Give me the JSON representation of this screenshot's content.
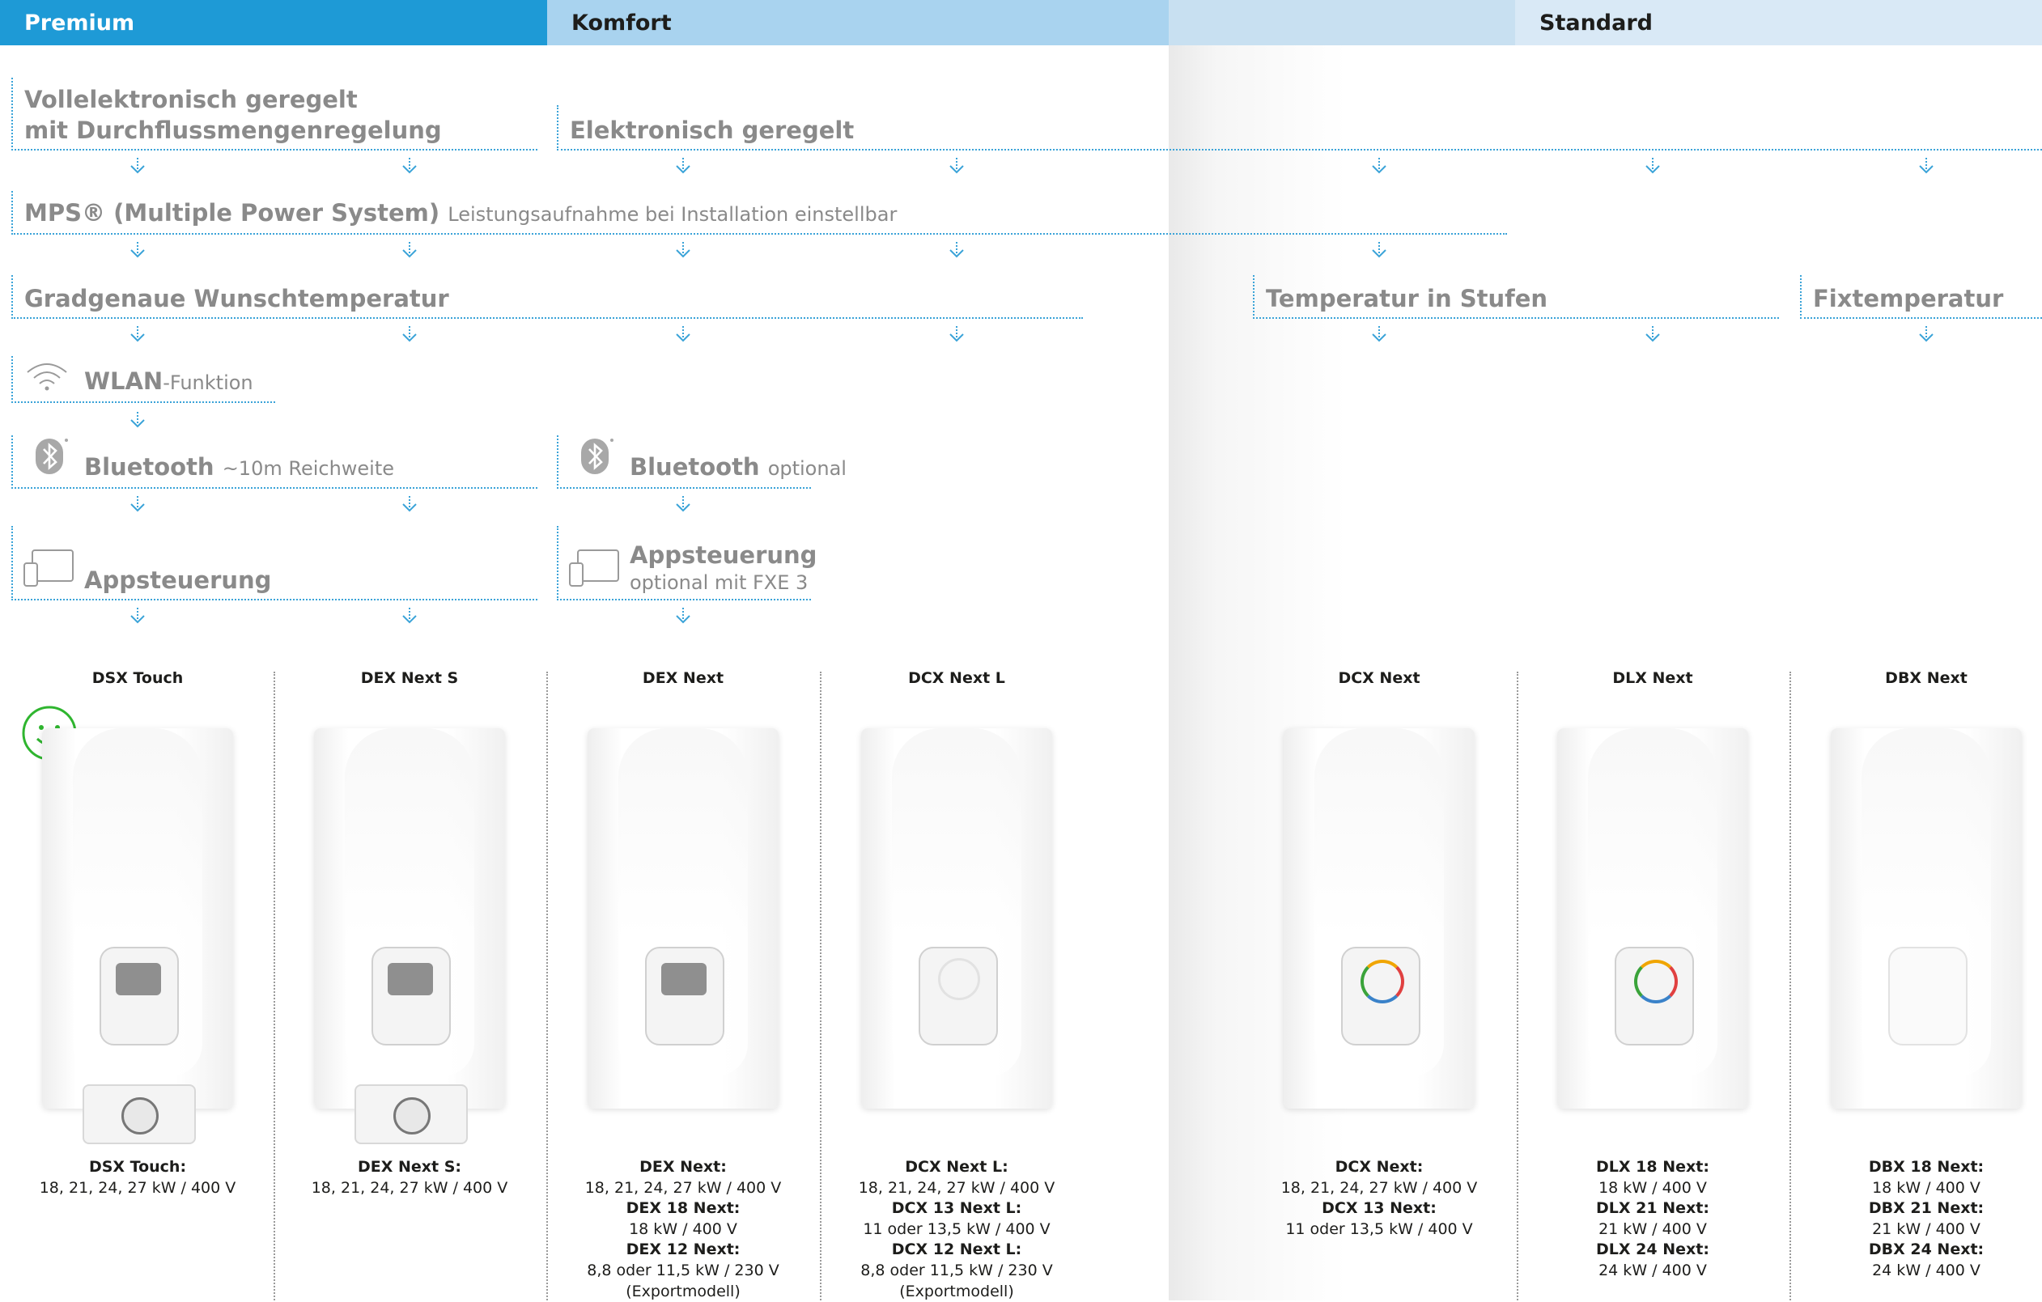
{
  "bands": {
    "premium": "Premium",
    "komfort": "Komfort",
    "standard": "Standard"
  },
  "features": {
    "vollelektronisch_line1": "Vollelektronisch geregelt",
    "vollelektronisch_line2": "mit Durchflussmengenregelung",
    "elektronisch": "Elektronisch geregelt",
    "mps_bold": "MPS® (Multiple Power System)",
    "mps_light": "Leistungsaufnahme bei Installation einstellbar",
    "gradgenau": "Gradgenaue Wunschtemperatur",
    "temperatur_stufen": "Temperatur in Stufen",
    "fixtemperatur": "Fixtemperatur",
    "wlan_bold": "WLAN",
    "wlan_light": "-Funktion",
    "bluetooth1_bold": "Bluetooth",
    "bluetooth1_light": "~10m Reichweite",
    "bluetooth2_bold": "Bluetooth",
    "bluetooth2_light": "optional",
    "app1": "Appsteuerung",
    "app2_line1": "Appsteuerung",
    "app2_line2": "optional mit FXE 3"
  },
  "icons": {
    "wifi": "wifi-icon",
    "bluetooth": "bluetooth-icon",
    "app": "tablet-phone-icon",
    "smiley": "smiley-icon",
    "arrow": "arrow-down-icon"
  },
  "colors": {
    "premium": "#1e9ad6",
    "komfort": "#a9d3ef",
    "standard": "#d9e9f6",
    "dotted_line": "#3aa3d8",
    "smiley": "#2fb52f"
  },
  "products": [
    {
      "title": "DSX Touch",
      "spec": [
        {
          "bold": "DSX Touch:",
          "normal": "18, 21, 24, 27 kW / 400 V"
        }
      ]
    },
    {
      "title": "DEX Next S",
      "spec": [
        {
          "bold": "DEX Next S:",
          "normal": "18, 21, 24, 27 kW / 400 V"
        }
      ]
    },
    {
      "title": "DEX Next",
      "spec": [
        {
          "bold": "DEX Next:",
          "normal": "18, 21, 24, 27 kW / 400 V"
        },
        {
          "bold": "DEX 18 Next:",
          "normal": "18 kW / 400 V"
        },
        {
          "bold": "DEX 12 Next:",
          "normal": "8,8 oder 11,5 kW / 230 V"
        },
        {
          "normal": "(Exportmodell)"
        }
      ]
    },
    {
      "title": "DCX Next L",
      "spec": [
        {
          "bold": "DCX Next L:",
          "normal": "18, 21, 24, 27 kW / 400 V"
        },
        {
          "bold": "DCX 13 Next L:",
          "normal": "11 oder 13,5 kW / 400 V"
        },
        {
          "bold": "DCX 12 Next L:",
          "normal": "8,8 oder 11,5 kW / 230 V"
        },
        {
          "normal": "(Exportmodell)"
        }
      ]
    },
    {
      "title": "DCX Next",
      "spec": [
        {
          "bold": "DCX Next:",
          "normal": "18, 21, 24, 27 kW / 400 V"
        },
        {
          "bold": "DCX 13 Next:",
          "normal": "11 oder 13,5 kW / 400 V"
        }
      ]
    },
    {
      "title": "DLX Next",
      "spec": [
        {
          "bold": "DLX 18 Next:",
          "normal": "18 kW / 400 V"
        },
        {
          "bold": "DLX 21 Next:",
          "normal": "21 kW / 400 V"
        },
        {
          "bold": "DLX 24 Next:",
          "normal": "24 kW / 400 V"
        }
      ]
    },
    {
      "title": "DBX Next",
      "spec": [
        {
          "bold": "DBX 18 Next:",
          "normal": "18 kW / 400 V"
        },
        {
          "bold": "DBX 21 Next:",
          "normal": "21 kW / 400 V"
        },
        {
          "bold": "DBX 24 Next:",
          "normal": "24 kW / 400 V"
        }
      ]
    }
  ]
}
